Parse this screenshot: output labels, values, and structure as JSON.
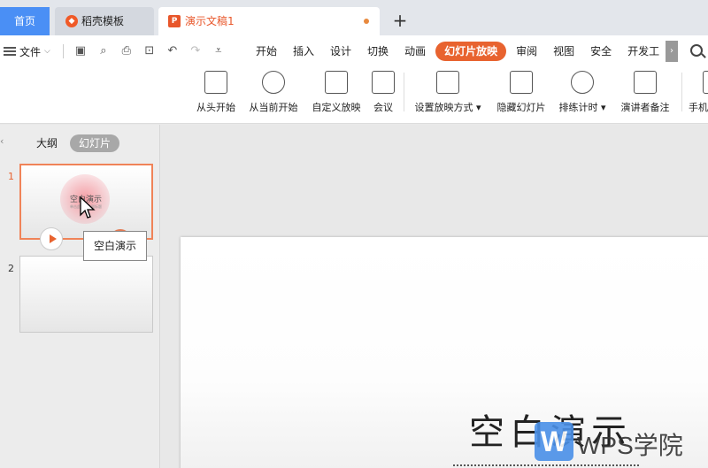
{
  "tabbar": {
    "home_label": "首页",
    "template_label": "稻壳模板",
    "template_icon": "daoke-logo-icon",
    "doc_label": "演示文稿1",
    "doc_icon": "presentation-file-icon",
    "doc_icon_letter": "P",
    "add_label": "+"
  },
  "menubar": {
    "file_label": "文件",
    "tabs": [
      "开始",
      "插入",
      "设计",
      "切换",
      "动画",
      "幻灯片放映",
      "审阅",
      "视图",
      "安全",
      "开发工"
    ],
    "active_tab": "幻灯片放映",
    "more_label": "›"
  },
  "toolbar": {
    "buttons": [
      {
        "label": "从头开始",
        "icon": "play-from-start-icon"
      },
      {
        "label": "从当前开始",
        "icon": "play-from-current-icon"
      },
      {
        "label": "自定义放映",
        "icon": "custom-show-icon"
      },
      {
        "label": "会议",
        "icon": "meeting-icon"
      },
      {
        "label": "设置放映方式",
        "icon": "slideshow-settings-icon"
      },
      {
        "label": "隐藏幻灯片",
        "icon": "hide-slide-icon"
      },
      {
        "label": "排练计时",
        "icon": "rehearse-timing-icon"
      },
      {
        "label": "演讲者备注",
        "icon": "speaker-notes-icon"
      },
      {
        "label": "手机",
        "icon": "phone-icon"
      }
    ]
  },
  "leftpane": {
    "tab_outline": "大纲",
    "tab_slides": "幻灯片",
    "active_tab": "幻灯片",
    "slides": [
      {
        "number": "1",
        "title": "空白演示",
        "subtitle": "单击此处输入副标题"
      },
      {
        "number": "2",
        "title": "",
        "subtitle": ""
      }
    ],
    "tooltip": "空白演示"
  },
  "editor": {
    "slide_title": "空白演示"
  },
  "watermark": {
    "logo_letter": "W",
    "text": "WPS学院"
  },
  "colors": {
    "accent": "#e8632f",
    "home_tab": "#4a8ff5"
  }
}
